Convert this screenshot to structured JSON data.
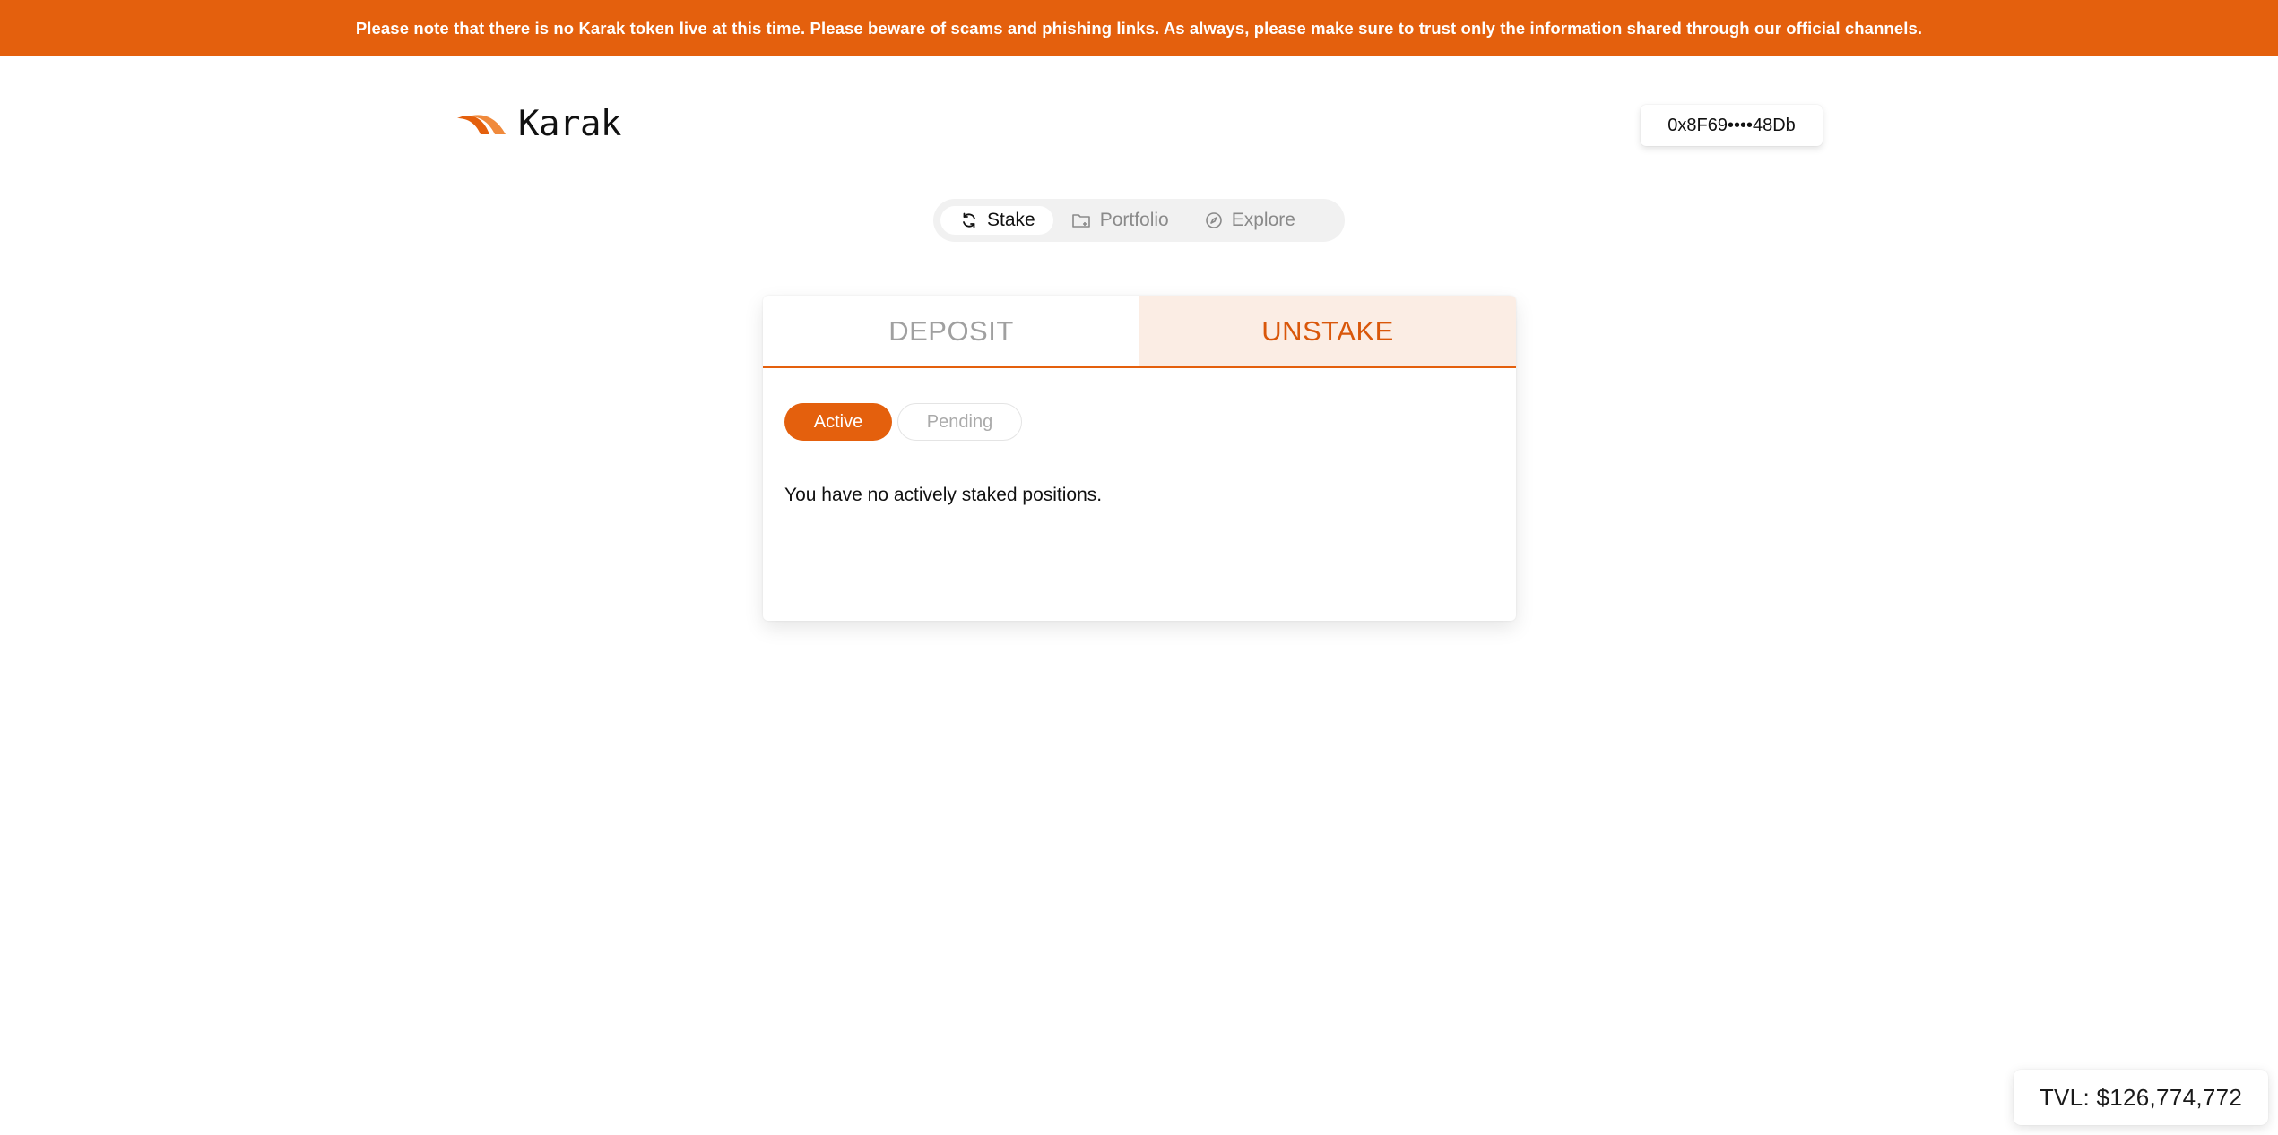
{
  "banner": {
    "text": "Please note that there is no Karak token live at this time. Please beware of scams and phishing links. As always, please make sure to trust only the information shared through our official channels."
  },
  "header": {
    "logo_text": "Karak",
    "logo_icon": "karak-wing-icon",
    "wallet_address": "0x8F69••••48Db"
  },
  "nav": {
    "items": [
      {
        "label": "Stake",
        "icon": "refresh-icon",
        "active": true
      },
      {
        "label": "Portfolio",
        "icon": "folder-icon",
        "active": false
      },
      {
        "label": "Explore",
        "icon": "compass-icon",
        "active": false
      }
    ]
  },
  "card": {
    "tabs": [
      {
        "label": "DEPOSIT",
        "active": false
      },
      {
        "label": "UNSTAKE",
        "active": true
      }
    ],
    "filters": [
      {
        "label": "Active",
        "active": true
      },
      {
        "label": "Pending",
        "active": false
      }
    ],
    "empty_message": "You have no actively staked positions."
  },
  "footer": {
    "tvl": "TVL: $126,774,772"
  },
  "colors": {
    "accent": "#E4600D",
    "accent_light": "#FBEDE4"
  }
}
